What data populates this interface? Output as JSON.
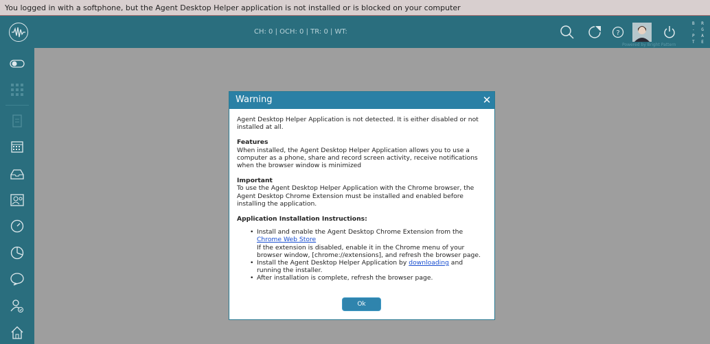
{
  "notice": {
    "text": "You logged in with a softphone, but the Agent Desktop Helper application is not installed or is blocked on your computer"
  },
  "topbar": {
    "stats": "CH: 0  |  OCH: 0  |  TR: 0  |  WT:",
    "powered_by": "Powered by Bright Pattern",
    "brand_lines": [
      "B R I",
      "- G H",
      "P A T",
      "T E R"
    ]
  },
  "dialog": {
    "title": "Warning",
    "close_label": "✕",
    "intro": "Agent Desktop Helper Application is not detected. It is either disabled or not installed at all.",
    "features_heading": "Features",
    "features_text": "When installed, the Agent Desktop Helper Application allows you to use a computer as a phone, share and record screen activity, receive notifications when the browser window is minimized",
    "important_heading": "Important",
    "important_text": "To use the Agent Desktop Helper Application with the Chrome browser, the Agent Desktop Chrome Extension must be installed and enabled before installing the application.",
    "instructions_heading": "Application Installation Instructions:",
    "step1_text": "Install and enable the Agent Desktop Chrome Extension from the ",
    "step1_link": "Chrome Web Store",
    "step1_note": "If the extension is disabled, enable it in the Chrome menu of your browser window, [chrome://extensions], and refresh the browser page.",
    "step2_text": "Install the Agent Desktop Helper Application by ",
    "step2_link": "downloading",
    "step2_after": " and running the installer.",
    "step3_text": "After installation is complete, refresh the browser page.",
    "ok_label": "Ok"
  },
  "colors": {
    "topbar": "#2a6e7e",
    "dialog_header": "#2a80a5",
    "overlay": "#9e9e9e"
  }
}
